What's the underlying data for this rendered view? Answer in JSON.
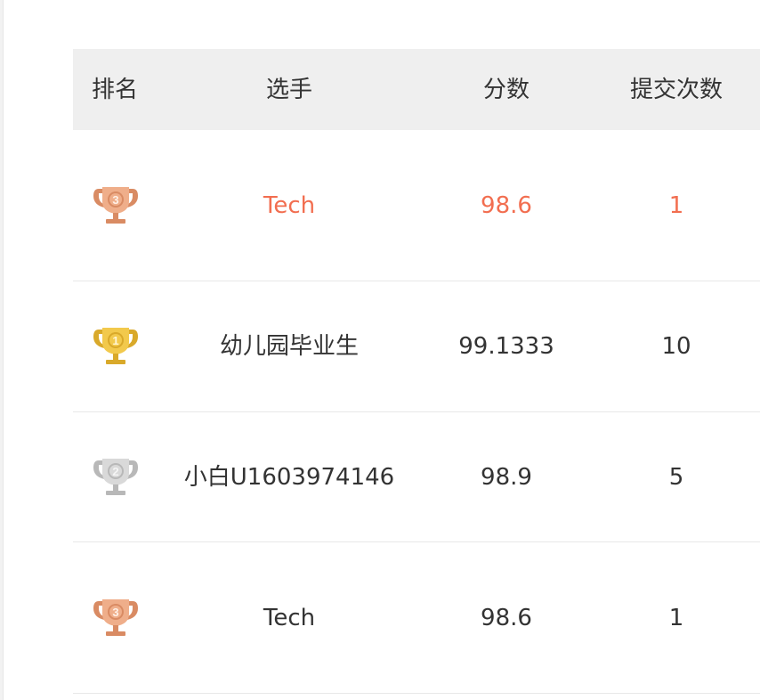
{
  "colors": {
    "highlight": "#f26e50",
    "header_bg": "#efefef",
    "gold": "#f2c94c",
    "silver": "#d9d9d9",
    "bronze": "#efae8a"
  },
  "leaderboard": {
    "columns": {
      "rank": "排名",
      "player": "选手",
      "score": "分数",
      "submissions": "提交次数"
    },
    "rows": [
      {
        "rank": 3,
        "trophy": "bronze-trophy-icon",
        "player": "Tech",
        "score": "98.6",
        "submissions": "1",
        "highlighted": true
      },
      {
        "rank": 1,
        "trophy": "gold-trophy-icon",
        "player": "幼儿园毕业生",
        "score": "99.1333",
        "submissions": "10",
        "highlighted": false
      },
      {
        "rank": 2,
        "trophy": "silver-trophy-icon",
        "player": "小白U1603974146",
        "score": "98.9",
        "submissions": "5",
        "highlighted": false
      },
      {
        "rank": 3,
        "trophy": "bronze-trophy-icon",
        "player": "Tech",
        "score": "98.6",
        "submissions": "1",
        "highlighted": false
      }
    ]
  }
}
